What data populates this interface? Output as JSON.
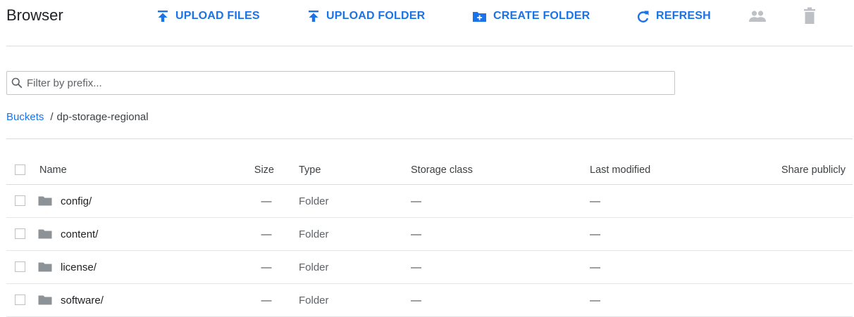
{
  "toolbar": {
    "title": "Browser",
    "upload_files_label": "UPLOAD FILES",
    "upload_folder_label": "UPLOAD FOLDER",
    "create_folder_label": "CREATE FOLDER",
    "refresh_label": "REFRESH",
    "permissions_icon": "people-icon",
    "delete_icon": "trash-icon",
    "accent_color": "#1a73e8",
    "disabled_icon_color": "#bdc1c6"
  },
  "filter": {
    "placeholder": "Filter by prefix...",
    "value": ""
  },
  "breadcrumb": {
    "root_label": "Buckets",
    "separator": "/",
    "current": "dp-storage-regional"
  },
  "table": {
    "columns": [
      "Name",
      "Size",
      "Type",
      "Storage class",
      "Last modified",
      "Share publicly"
    ],
    "rows": [
      {
        "name": "config/",
        "size": "—",
        "type": "Folder",
        "storage_class": "—",
        "last_modified": "—"
      },
      {
        "name": "content/",
        "size": "—",
        "type": "Folder",
        "storage_class": "—",
        "last_modified": "—"
      },
      {
        "name": "license/",
        "size": "—",
        "type": "Folder",
        "storage_class": "—",
        "last_modified": "—"
      },
      {
        "name": "software/",
        "size": "—",
        "type": "Folder",
        "storage_class": "—",
        "last_modified": "—"
      }
    ]
  }
}
